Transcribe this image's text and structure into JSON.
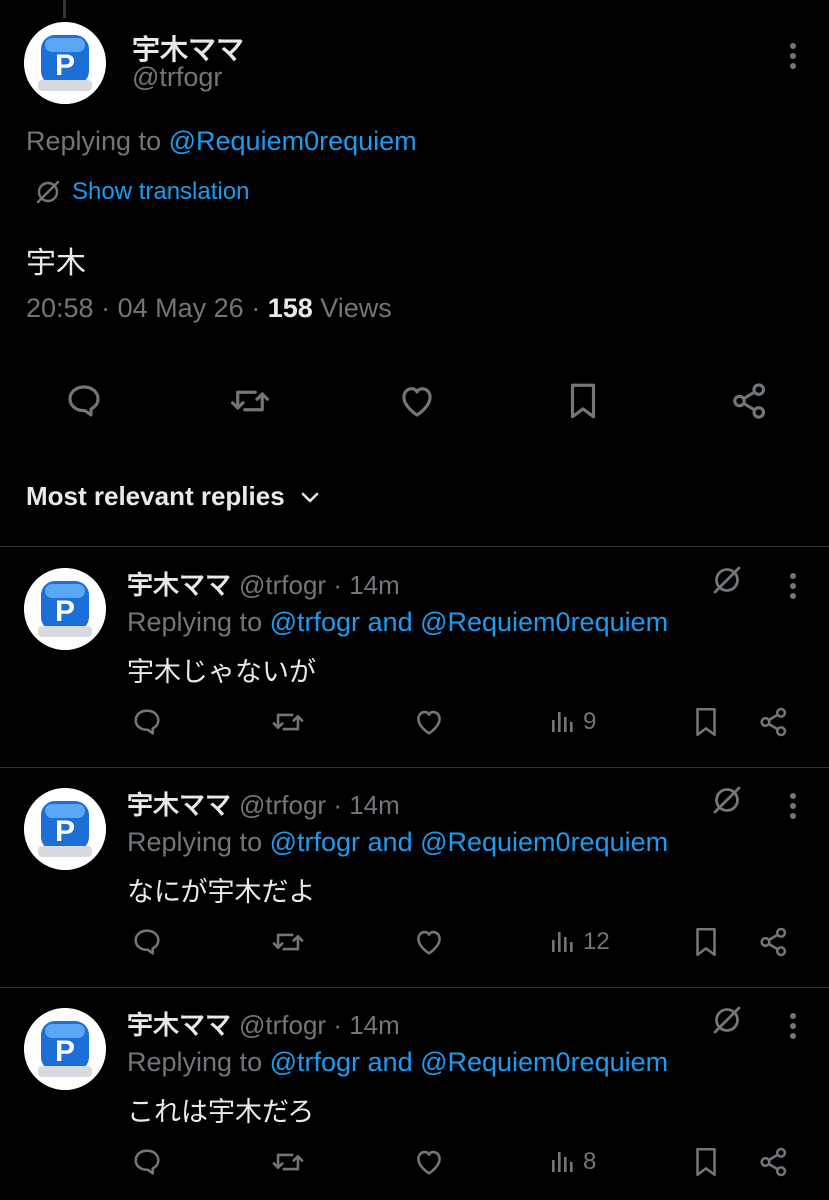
{
  "main_tweet": {
    "display_name": "宇木ママ",
    "handle": "@trfogr",
    "replying_prefix": "Replying to",
    "replying_to": "@Requiem0requiem",
    "translation_label": "Show translation",
    "text": "宇木",
    "time": "20:58",
    "date": "04 May 26",
    "views_count": "158",
    "views_label": "Views",
    "avatar_letter": "P"
  },
  "sort_label": "Most relevant replies",
  "replies": [
    {
      "display_name": "宇木ママ",
      "handle": "@trfogr",
      "age": "14m",
      "replying_prefix": "Replying to",
      "replying_to": "@trfogr and @Requiem0requiem",
      "text": "宇木じゃないが",
      "views": "9",
      "avatar_letter": "P"
    },
    {
      "display_name": "宇木ママ",
      "handle": "@trfogr",
      "age": "14m",
      "replying_prefix": "Replying to",
      "replying_to": "@trfogr and @Requiem0requiem",
      "text": "なにが宇木だよ",
      "views": "12",
      "avatar_letter": "P"
    },
    {
      "display_name": "宇木ママ",
      "handle": "@trfogr",
      "age": "14m",
      "replying_prefix": "Replying to",
      "replying_to": "@trfogr and @Requiem0requiem",
      "text": "これは宇木だろ",
      "views": "8",
      "avatar_letter": "P"
    }
  ],
  "colors": {
    "background": "#000000",
    "text_primary": "#e7e9ea",
    "text_secondary": "#71767b",
    "link": "#1d9bf0",
    "divider": "#2f3336",
    "avatar_badge": "#1d6fd8"
  },
  "icons": {
    "more": "more-vertical-icon",
    "translate": "translate-icon",
    "reply": "reply-icon",
    "retweet": "retweet-icon",
    "like": "heart-icon",
    "bookmark": "bookmark-icon",
    "share": "share-icon",
    "views": "views-chart-icon",
    "grok": "grok-icon",
    "sort": "chevron-down-icon"
  }
}
